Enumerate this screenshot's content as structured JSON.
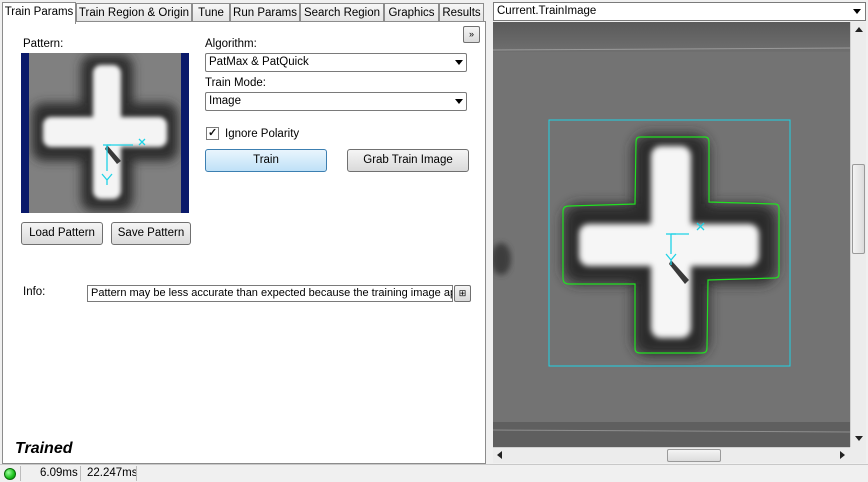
{
  "tabs": [
    {
      "label": "Train Params"
    },
    {
      "label": "Train Region & Origin"
    },
    {
      "label": "Tune"
    },
    {
      "label": "Run Params"
    },
    {
      "label": "Search Region"
    },
    {
      "label": "Graphics"
    },
    {
      "label": "Results"
    }
  ],
  "pattern": {
    "label": "Pattern:",
    "load_label": "Load Pattern",
    "save_label": "Save Pattern"
  },
  "algorithm": {
    "label": "Algorithm:",
    "value": "PatMax & PatQuick"
  },
  "train_mode": {
    "label": "Train Mode:",
    "value": "Image"
  },
  "ignore_polarity": {
    "label": "Ignore Polarity",
    "checked": true
  },
  "buttons": {
    "train_label": "Train",
    "grab_label": "Grab Train Image"
  },
  "info": {
    "label": "Info:",
    "value": "Pattern may be less accurate than expected because the training image app"
  },
  "trained_status": "Trained",
  "image_view": {
    "selector_value": "Current.TrainImage"
  },
  "status_bar": {
    "time1": "6.09ms",
    "time2": "22.247ms"
  },
  "colors": {
    "accent_cyan": "#1fd3e6",
    "contour_green": "#22e022",
    "pattern_bg": "#0a1a6b",
    "led_green": "#19c019"
  }
}
